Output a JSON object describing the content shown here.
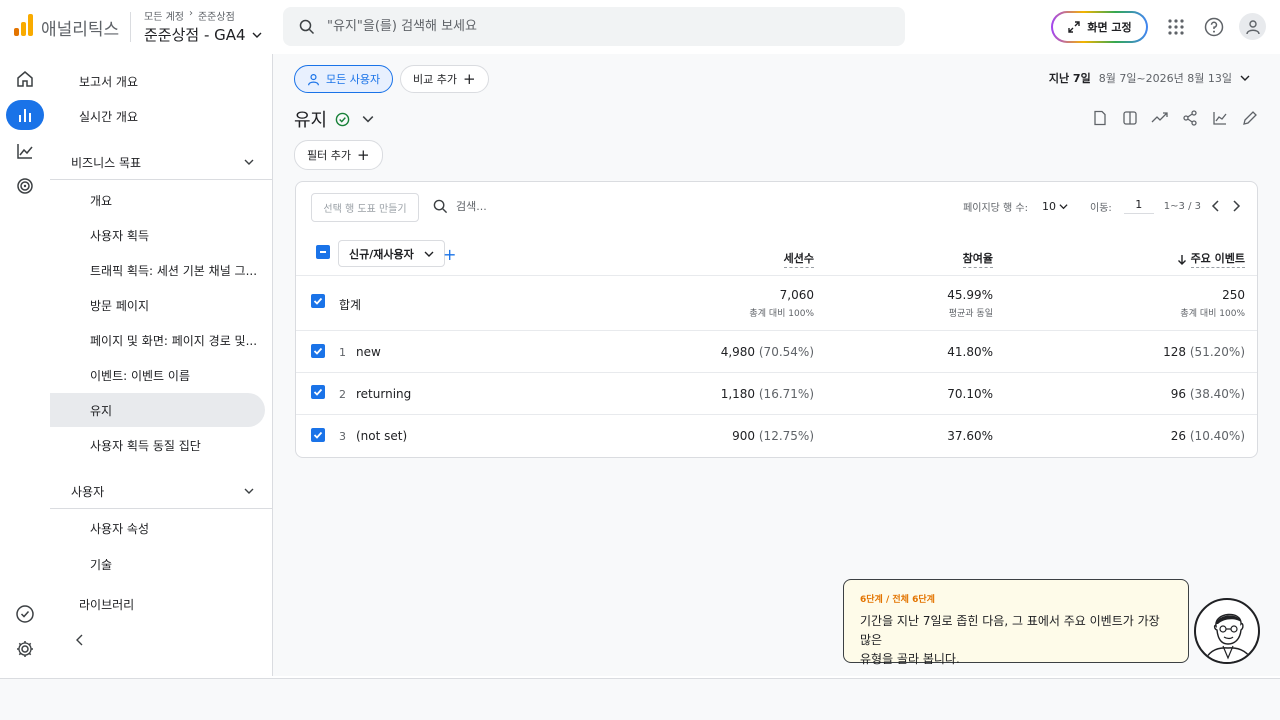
{
  "header": {
    "app_name": "애널리틱스",
    "account_breadcrumb": [
      "모든 계정",
      "준준상점"
    ],
    "property": "준준상점 - GA4",
    "search_placeholder": "\"유지\"을(를) 검색해 보세요",
    "pin_label": "화면 고정"
  },
  "sidebar": {
    "report_overview": "보고서 개요",
    "realtime_overview": "실시간 개요",
    "business_section": "비즈니스 목표",
    "business_items": [
      "개요",
      "사용자 획득",
      "트래픽 획득: 세션 기본 채널 그...",
      "방문 페이지",
      "페이지 및 화면: 페이지 경로 및...",
      "이벤트: 이벤트 이름",
      "유지",
      "사용자 획득 동질 집단"
    ],
    "user_section": "사용자",
    "user_items": [
      "사용자 속성",
      "기술"
    ],
    "library": "라이브러리"
  },
  "toolbar": {
    "all_users": "모든 사용자",
    "add_comparison": "비교 추가",
    "date_label": "지난 7일",
    "date_range": "8월 7일~2026년 8월 13일",
    "add_filter": "필터 추가"
  },
  "page": {
    "title": "유지"
  },
  "table": {
    "plot_button": "선택 행 도표 만들기",
    "search_placeholder": "검색...",
    "rows_per_page_label": "페이지당 행 수:",
    "rows_per_page": "10",
    "goto_label": "이동:",
    "goto_value": "1",
    "range": "1~3 / 3",
    "dimension": "신규/재사용자",
    "columns": [
      "세션수",
      "참여율",
      "주요 이벤트"
    ],
    "total": {
      "label": "합계",
      "sessions": "7,060",
      "sessions_sub": "총계 대비 100%",
      "engagement": "45.99%",
      "engagement_sub": "평균과 동일",
      "key_events": "250",
      "key_events_sub": "총계 대비 100%"
    },
    "rows": [
      {
        "num": "1",
        "label": "new",
        "sessions": "4,980",
        "sessions_pct": "(70.54%)",
        "engagement": "41.80%",
        "key_events": "128",
        "key_events_pct": "(51.20%)"
      },
      {
        "num": "2",
        "label": "returning",
        "sessions": "1,180",
        "sessions_pct": "(16.71%)",
        "engagement": "70.10%",
        "key_events": "96",
        "key_events_pct": "(38.40%)"
      },
      {
        "num": "3",
        "label": "(not set)",
        "sessions": "900",
        "sessions_pct": "(12.75%)",
        "engagement": "37.60%",
        "key_events": "26",
        "key_events_pct": "(10.40%)"
      }
    ]
  },
  "tutorial": {
    "step": "6단계 / 전체 6단계",
    "message_line1": "기간을 지난 7일로 좁힌 다음, 그 표에서 주요 이벤트가 가장 많은",
    "message_line2": "유형을 골라 봅니다."
  },
  "colors": {
    "accent": "#1a73e8",
    "logo_orange": "#f9ab00",
    "logo_dark": "#e37400",
    "success": "#188038"
  }
}
